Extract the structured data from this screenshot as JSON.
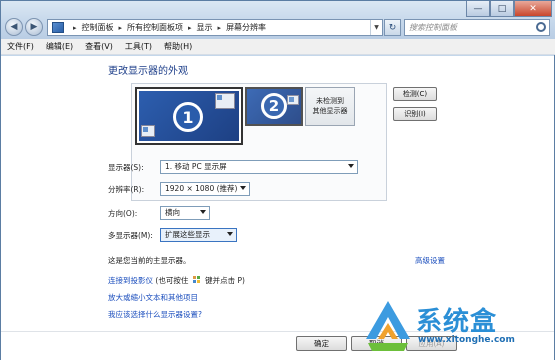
{
  "window": {
    "minimize": "—",
    "maximize": "□",
    "close": "✕"
  },
  "nav": {
    "back": "◀",
    "forward": "▶",
    "refresh": "↻"
  },
  "breadcrumb": [
    "控制面板",
    "所有控制面板项",
    "显示",
    "屏幕分辨率"
  ],
  "search": {
    "placeholder": "搜索控制面板"
  },
  "menu": [
    "文件(F)",
    "编辑(E)",
    "查看(V)",
    "工具(T)",
    "帮助(H)"
  ],
  "main": {
    "title": "更改显示器的外观",
    "monitor1_number": "1",
    "monitor2_number": "2",
    "undetected_line1": "未检测到",
    "undetected_line2": "其他显示器",
    "detect_button": "检测(C)",
    "identify_button": "识别(I)",
    "display_label": "显示器(S):",
    "display_value": "1. 移动 PC 显示屏",
    "resolution_label": "分辨率(R):",
    "resolution_value": "1920 × 1080 (推荐)",
    "orientation_label": "方向(O):",
    "orientation_value": "横向",
    "multi_label": "多显示器(M):",
    "multi_value": "扩展这些显示",
    "primary_note": "这是您当前的主显示器。",
    "advanced_link": "高级设置",
    "projector_link": "连接到投影仪",
    "projector_hint_prefix": "(也可按住",
    "projector_hint_suffix": "键并点击 P)",
    "text_size_link": "放大或缩小文本和其他项目",
    "which_settings_link": "我应该选择什么显示器设置?"
  },
  "footer": {
    "ok": "确定",
    "cancel": "取消",
    "apply": "应用(A)"
  },
  "watermark": {
    "brand": "系统盒",
    "url": "www.xitonghe.com"
  }
}
